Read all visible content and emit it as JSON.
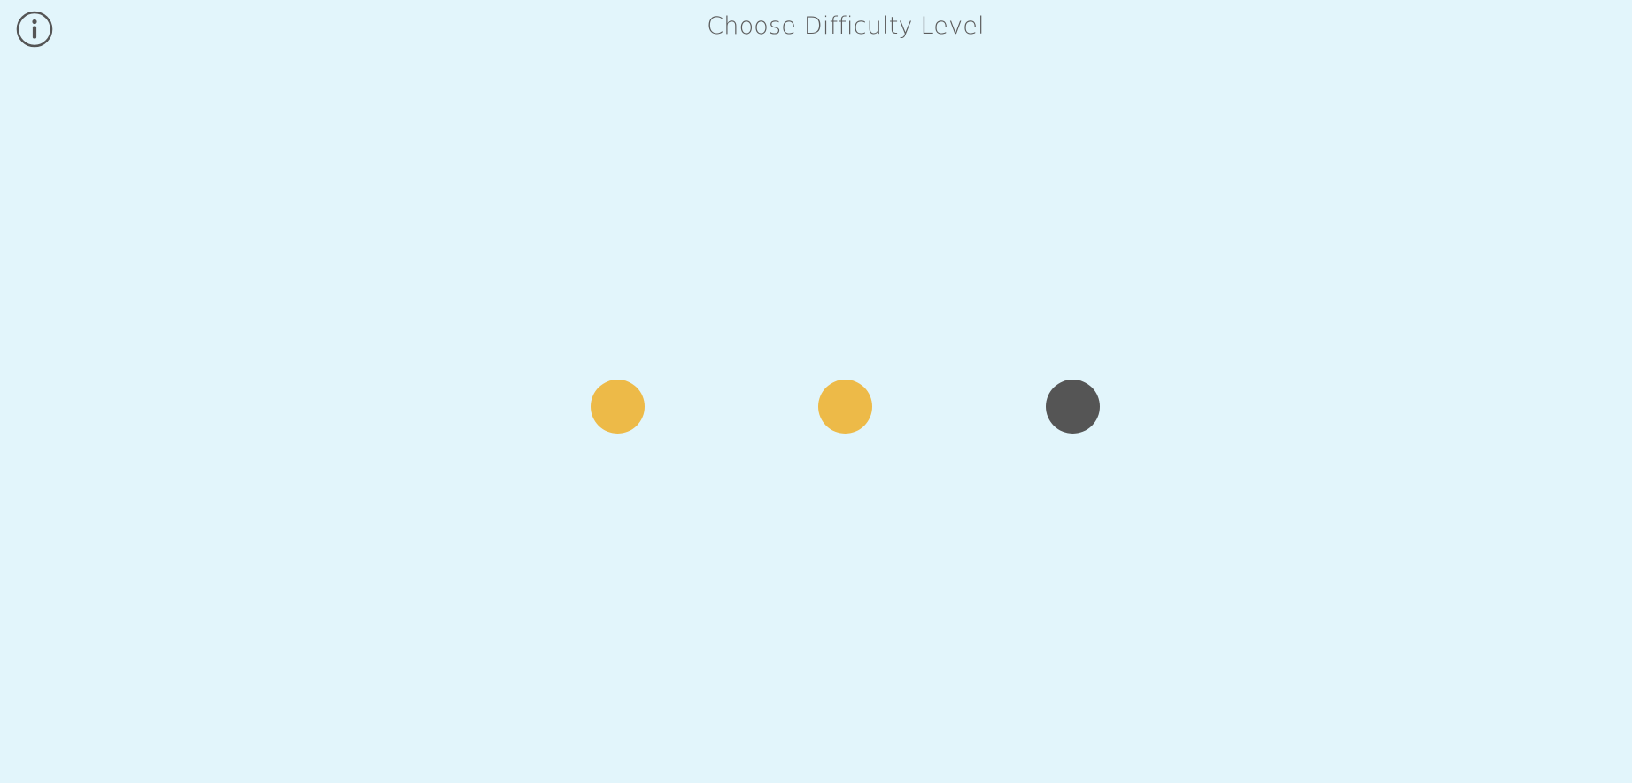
{
  "header": {
    "title": "Choose Difficulty Level",
    "info_icon": "info-circle-icon"
  },
  "colors": {
    "background": "#e2f5fb",
    "title_text": "#5c5c5c",
    "icon_stroke": "#555555"
  },
  "levels": [
    {
      "state": "available",
      "color": "#edba48"
    },
    {
      "state": "available",
      "color": "#edba48"
    },
    {
      "state": "locked",
      "color": "#555555"
    }
  ]
}
